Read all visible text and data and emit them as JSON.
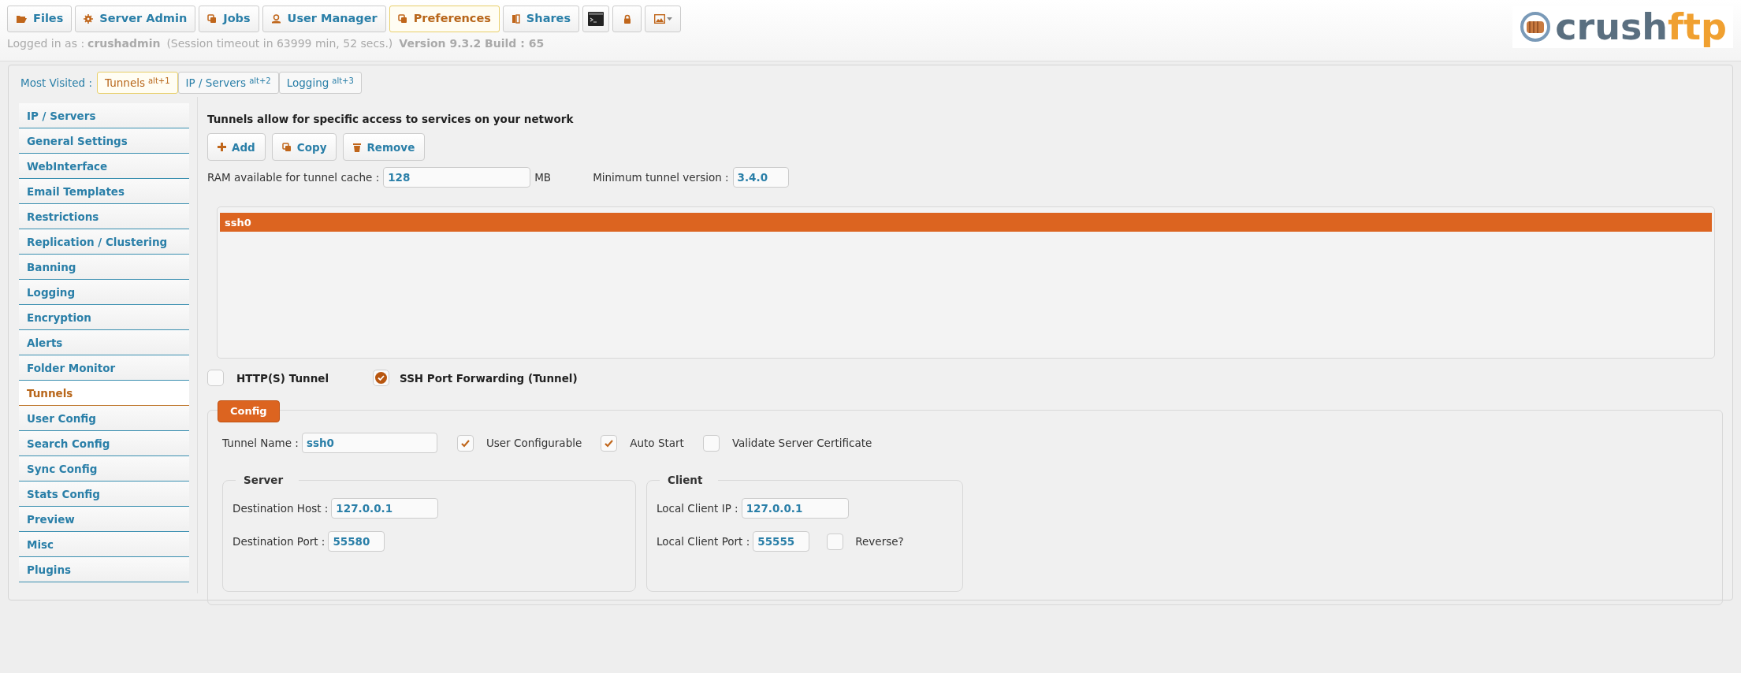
{
  "nav_buttons": [
    {
      "label": "Files",
      "selected": false
    },
    {
      "label": "Server Admin",
      "selected": false
    },
    {
      "label": "Jobs",
      "selected": false
    },
    {
      "label": "User Manager",
      "selected": false
    },
    {
      "label": "Preferences",
      "selected": true
    },
    {
      "label": "Shares",
      "selected": false
    }
  ],
  "logo": {
    "name": "crush",
    "suffix": "ftp"
  },
  "session": {
    "label": "Logged in as :",
    "user": "crushadmin",
    "timeout": "(Session timeout in 63999 min, 52 secs.)",
    "version": "Version 9.3.2 Build : 65"
  },
  "most_visited": {
    "label": "Most Visited :",
    "tabs": [
      {
        "label": "Tunnels",
        "shortcut": "alt+1",
        "selected": true
      },
      {
        "label": "IP / Servers",
        "shortcut": "alt+2",
        "selected": false
      },
      {
        "label": "Logging",
        "shortcut": "alt+3",
        "selected": false
      }
    ]
  },
  "sidebar": {
    "items": [
      {
        "label": "IP / Servers",
        "selected": false
      },
      {
        "label": "General Settings",
        "selected": false
      },
      {
        "label": "WebInterface",
        "selected": false
      },
      {
        "label": "Email Templates",
        "selected": false
      },
      {
        "label": "Restrictions",
        "selected": false
      },
      {
        "label": "Replication / Clustering",
        "selected": false
      },
      {
        "label": "Banning",
        "selected": false
      },
      {
        "label": "Logging",
        "selected": false
      },
      {
        "label": "Encryption",
        "selected": false
      },
      {
        "label": "Alerts",
        "selected": false
      },
      {
        "label": "Folder Monitor",
        "selected": false
      },
      {
        "label": "Tunnels",
        "selected": true
      },
      {
        "label": "User Config",
        "selected": false
      },
      {
        "label": "Search Config",
        "selected": false
      },
      {
        "label": "Sync Config",
        "selected": false
      },
      {
        "label": "Stats Config",
        "selected": false
      },
      {
        "label": "Preview",
        "selected": false
      },
      {
        "label": "Misc",
        "selected": false
      },
      {
        "label": "Plugins",
        "selected": false
      }
    ]
  },
  "tunnels": {
    "description": "Tunnels allow for specific access to services on your network",
    "buttons": [
      "Add",
      "Copy",
      "Remove"
    ],
    "ram_label": "RAM available for tunnel cache :",
    "ram_value": "128",
    "ram_unit": "MB",
    "min_version_label": "Minimum tunnel version :",
    "min_version_value": "3.4.0",
    "list": [
      {
        "name": "ssh0",
        "selected": true
      }
    ],
    "types": [
      {
        "label": "HTTP(S) Tunnel",
        "checked": false
      },
      {
        "label": "SSH Port Forwarding (Tunnel)",
        "checked": true
      }
    ]
  },
  "config": {
    "legend": "Config",
    "tunnel_name_label": "Tunnel Name :",
    "tunnel_name": "ssh0",
    "options": [
      {
        "label": "User Configurable",
        "checked": true
      },
      {
        "label": "Auto Start",
        "checked": true
      },
      {
        "label": "Validate Server Certificate",
        "checked": false
      }
    ],
    "server": {
      "legend": "Server",
      "fields": [
        {
          "label": "Destination Host :",
          "value": "127.0.0.1",
          "kind": "address"
        },
        {
          "label": "Destination Port :",
          "value": "55580",
          "kind": "port"
        }
      ]
    },
    "client": {
      "legend": "Client",
      "fields": [
        {
          "label": "Local Client IP :",
          "value": "127.0.0.1",
          "kind": "address"
        },
        {
          "label": "Local Client Port :",
          "value": "55555",
          "kind": "port"
        }
      ],
      "reverse": {
        "label": "Reverse?",
        "checked": false
      }
    }
  }
}
